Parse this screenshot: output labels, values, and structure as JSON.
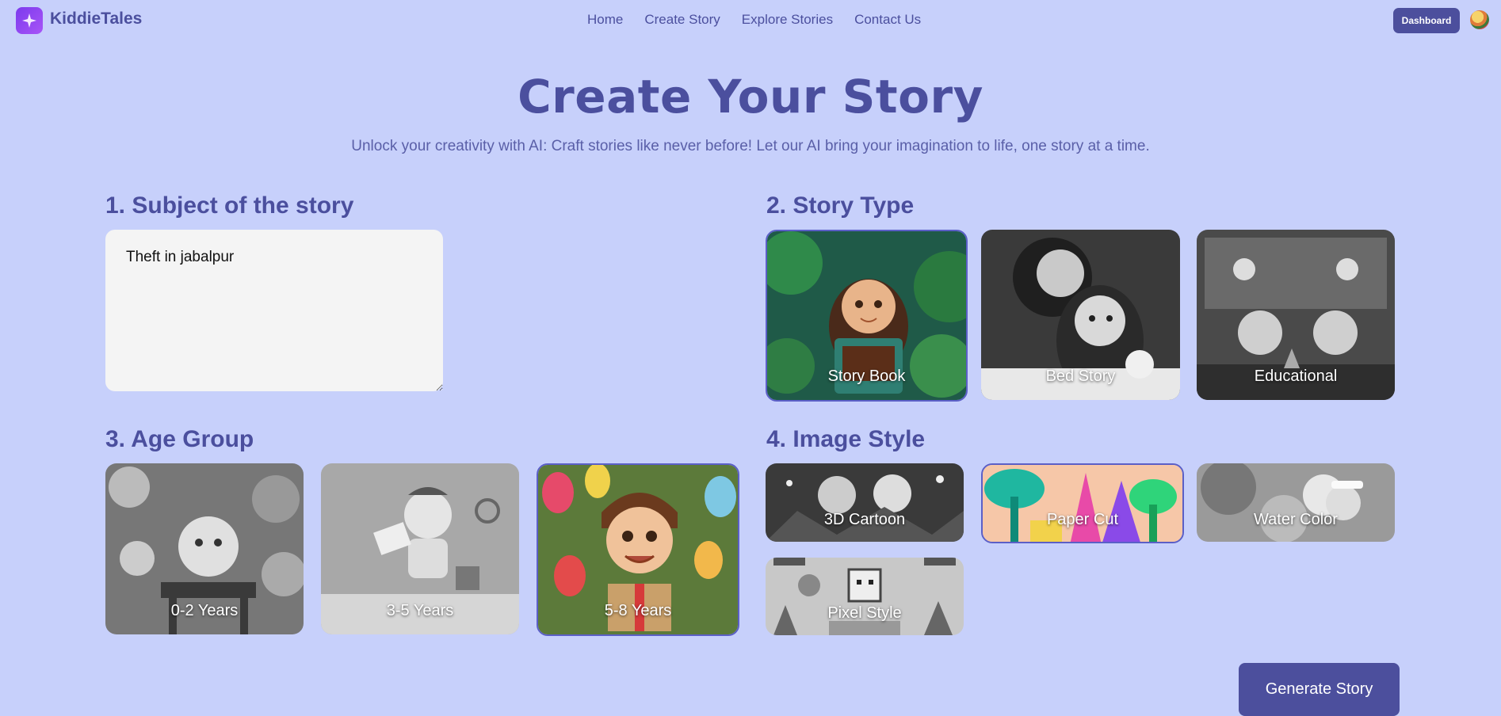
{
  "nav": {
    "brand": "KiddieTales",
    "links": [
      "Home",
      "Create Story",
      "Explore Stories",
      "Contact Us"
    ],
    "dashboard_label": "Dashboard"
  },
  "hero": {
    "title": "Create Your Story",
    "subtitle": "Unlock your creativity with AI: Craft stories like never before! Let our AI bring your imagination to life, one story at a time."
  },
  "sections": {
    "subject": {
      "title": "1. Subject of the story",
      "value": "Theft in jabalpur"
    },
    "story_type": {
      "title": "2. Story Type",
      "options": [
        {
          "label": "Story Book",
          "selected": true
        },
        {
          "label": "Bed Story",
          "selected": false
        },
        {
          "label": "Educational",
          "selected": false
        }
      ]
    },
    "age_group": {
      "title": "3. Age Group",
      "options": [
        {
          "label": "0-2 Years",
          "selected": false
        },
        {
          "label": "3-5 Years",
          "selected": false
        },
        {
          "label": "5-8 Years",
          "selected": true
        }
      ]
    },
    "image_style": {
      "title": "4. Image Style",
      "options": [
        {
          "label": "3D Cartoon",
          "selected": false
        },
        {
          "label": "Paper Cut",
          "selected": true
        },
        {
          "label": "Water Color",
          "selected": false
        },
        {
          "label": "Pixel Style",
          "selected": false
        }
      ]
    }
  },
  "generate_label": "Generate Story",
  "colors": {
    "background": "#c7d0fb",
    "accent": "#4c4f9d",
    "heading": "#4b4f9e"
  }
}
